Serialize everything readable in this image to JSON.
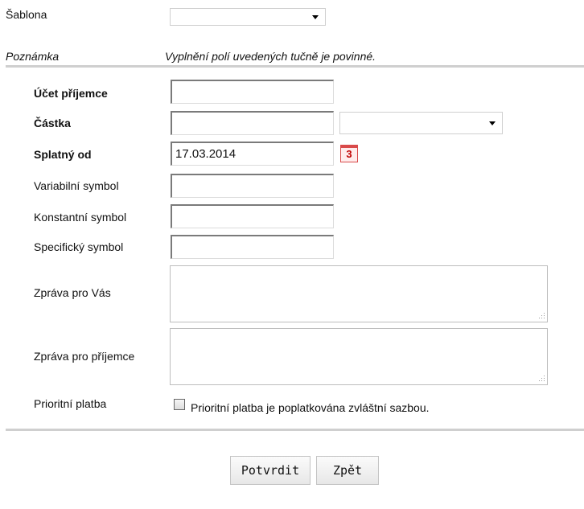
{
  "template_label": "Šablona",
  "template_select_value": "",
  "note_label": "Poznámka",
  "note_text": "Vyplnění polí uvedených tučně je povinné.",
  "fields": {
    "recipient_account_label": "Účet příjemce",
    "recipient_account_value": "",
    "amount_label": "Částka",
    "amount_value": "",
    "currency_value": "",
    "due_from_label": "Splatný od",
    "due_from_value": "17.03.2014",
    "calendar_icon_glyph": "3",
    "variable_symbol_label": "Variabilní symbol",
    "variable_symbol_value": "",
    "constant_symbol_label": "Konstantní symbol",
    "constant_symbol_value": "",
    "specific_symbol_label": "Specifický symbol",
    "specific_symbol_value": "",
    "message_for_you_label": "Zpráva pro Vás",
    "message_for_you_value": "",
    "message_for_recipient_label": "Zpráva pro příjemce",
    "message_for_recipient_value": "",
    "priority_label": "Prioritní platba",
    "priority_checkbox_text": "Prioritní platba je poplatkována zvláštní sazbou.",
    "priority_checked": false
  },
  "buttons": {
    "confirm": "Potvrdit",
    "back": "Zpět"
  },
  "colors": {
    "rule": "#cfcfcf",
    "calendar_accent": "#d94a4a"
  },
  "icons": {
    "calendar": "calendar-icon",
    "dropdown": "chevron-down-icon",
    "resize": "resize-grip-icon"
  }
}
